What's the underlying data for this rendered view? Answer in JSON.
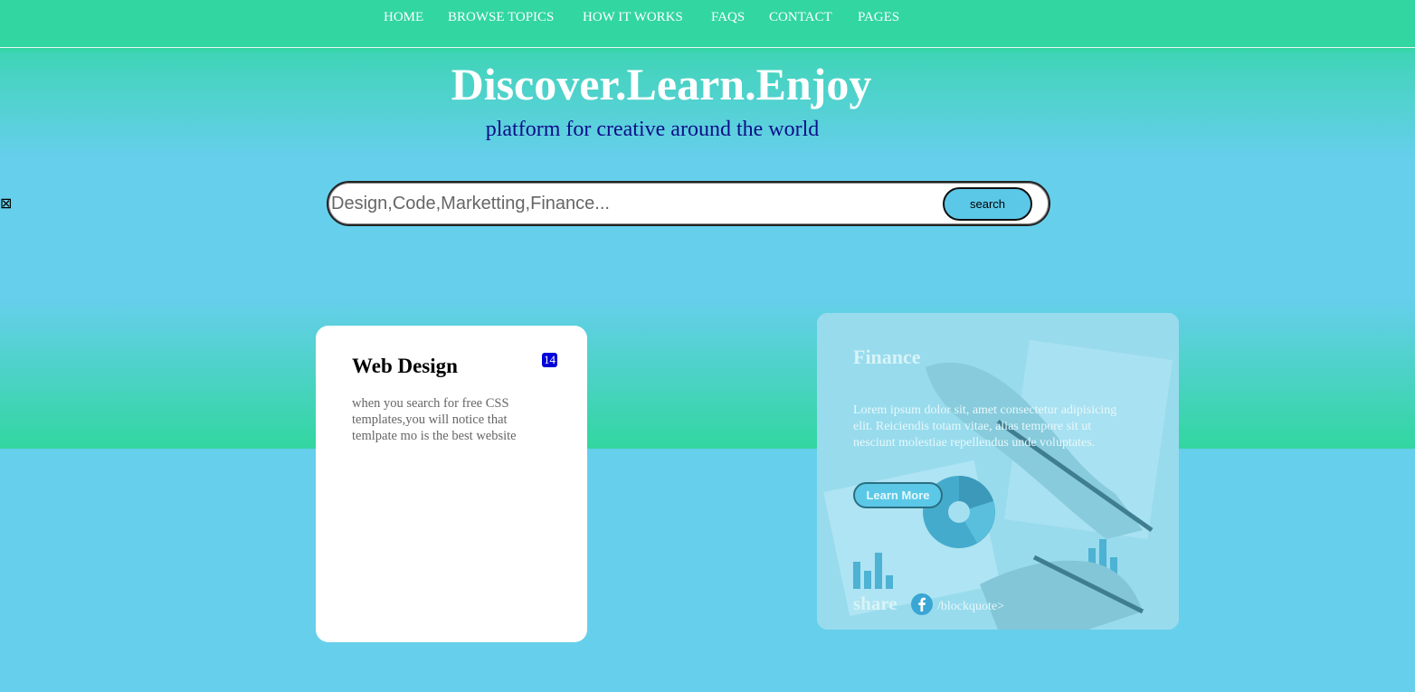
{
  "nav": {
    "items": [
      {
        "label": "HOME"
      },
      {
        "label": "BROWSE TOPICS"
      },
      {
        "label": "HOW IT WORKS"
      },
      {
        "label": "FAQS"
      },
      {
        "label": "CONTACT"
      },
      {
        "label": "PAGES"
      }
    ]
  },
  "hero": {
    "title": "Discover.Learn.Enjoy",
    "subtitle": "platform for creative around the world"
  },
  "side_glyph": "⊠",
  "search": {
    "placeholder": "Design,Code,Marketting,Finance...",
    "value": "",
    "button_label": "search"
  },
  "cards": {
    "web_design": {
      "title": "Web Design",
      "badge": "14",
      "text": "when you search for free CSS templates,you will notice that temlpate mo is the best website"
    },
    "finance": {
      "title": "Finance",
      "text": "Lorem ipsum dolor sit, amet consectetur adipisicing elit. Reiciendis totam vitae, alias tempore sit ut nesciunt molestiae repellendus unde voluptates.",
      "button_label": "Learn More",
      "share_label": "share",
      "share_icon": "facebook-icon",
      "share_tail": "/blockquote>"
    }
  },
  "colors": {
    "nav_bg": "#32d6a0",
    "hero_mid": "#66cfec",
    "page_bg": "#66cfec",
    "subtitle": "#0d0d8a",
    "badge": "#0000d8",
    "button": "#5bc8e8"
  }
}
